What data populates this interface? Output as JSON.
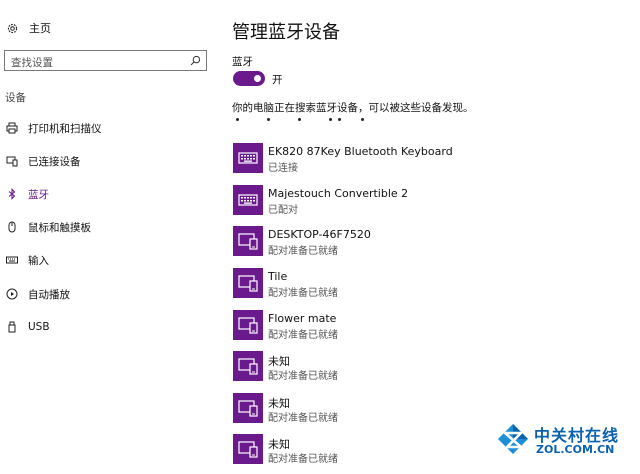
{
  "sidebar": {
    "home_label": "主页",
    "search_placeholder": "查找设置",
    "section_title": "设备",
    "items": [
      {
        "label": "打印机和扫描仪",
        "icon": "printer-icon"
      },
      {
        "label": "已连接设备",
        "icon": "connected-devices-icon"
      },
      {
        "label": "蓝牙",
        "icon": "bluetooth-icon",
        "active": true
      },
      {
        "label": "鼠标和触摸板",
        "icon": "mouse-icon"
      },
      {
        "label": "输入",
        "icon": "keyboard-icon"
      },
      {
        "label": "自动播放",
        "icon": "autoplay-icon"
      },
      {
        "label": "USB",
        "icon": "usb-icon"
      }
    ]
  },
  "main": {
    "title": "管理蓝牙设备",
    "bluetooth_label": "蓝牙",
    "toggle_state": "开",
    "toggle_on": true,
    "discoverable_text": "你的电脑正在搜索蓝牙设备，可以被这些设备发现。",
    "devices": [
      {
        "name": "EK820 87Key Bluetooth Keyboard",
        "status": "已连接",
        "icon": "keyboard-icon"
      },
      {
        "name": "Majestouch Convertible 2",
        "status": "已配对",
        "icon": "keyboard-icon"
      },
      {
        "name": "DESKTOP-46F7520",
        "status": "配对准备已就绪",
        "icon": "device-icon"
      },
      {
        "name": "Tile",
        "status": "配对准备已就绪",
        "icon": "device-icon"
      },
      {
        "name": "Flower mate",
        "status": "配对准备已就绪",
        "icon": "device-icon"
      },
      {
        "name": "未知",
        "status": "配对准备已就绪",
        "icon": "device-icon"
      },
      {
        "name": "未知",
        "status": "配对准备已就绪",
        "icon": "device-icon"
      },
      {
        "name": "未知",
        "status": "配对准备已就绪",
        "icon": "device-icon"
      }
    ]
  },
  "watermark": {
    "cn": "中关村在线",
    "en": "ZOL.COM.CN"
  },
  "colors": {
    "accent": "#6b1a8e",
    "watermark_blue": "#0b63b0"
  }
}
